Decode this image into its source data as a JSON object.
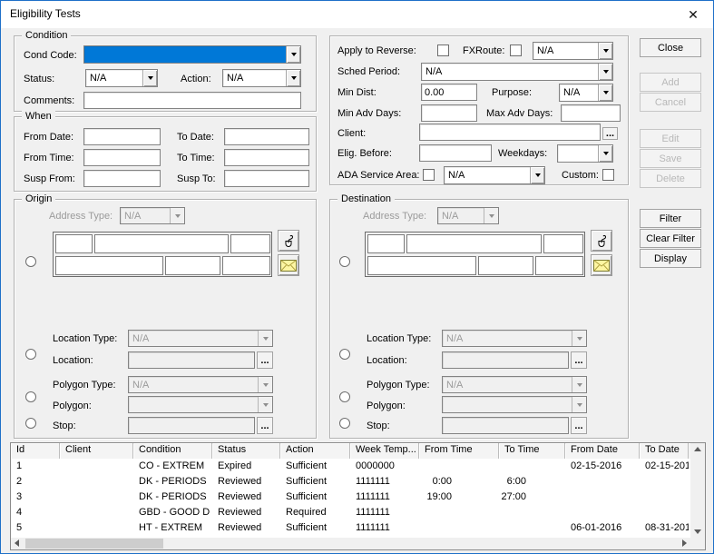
{
  "window": {
    "title": "Eligibility Tests",
    "close_glyph": "✕"
  },
  "colors": {
    "accent": "#0078d7",
    "cond_code_selection": "#0078d7",
    "envelope_yellow": "#fdf6a3"
  },
  "icons": {
    "close": "close-icon",
    "dropdown": "chevron-down-icon",
    "address_pick": "mouse-icon",
    "address_mail": "envelope-icon",
    "browse": "ellipsis-icon",
    "scroll_arrows": [
      "arrow-up-icon",
      "arrow-down-icon",
      "arrow-left-icon",
      "arrow-right-icon"
    ]
  },
  "condition": {
    "legend": "Condition",
    "cond_code_label": "Cond Code:",
    "cond_code_value": "",
    "status_label": "Status:",
    "status_value": "N/A",
    "action_label": "Action:",
    "action_value": "N/A",
    "comments_label": "Comments:",
    "comments_value": ""
  },
  "options": {
    "apply_to_reverse_label": "Apply to Reverse:",
    "fxroute_label": "FXRoute:",
    "fxroute_value": "N/A",
    "sched_period_label": "Sched Period:",
    "sched_period_value": "N/A",
    "min_dist_label": "Min Dist:",
    "min_dist_value": "0.00",
    "purpose_label": "Purpose:",
    "purpose_value": "N/A",
    "min_adv_days_label": "Min Adv Days:",
    "min_adv_days_value": "",
    "max_adv_days_label": "Max Adv Days:",
    "max_adv_days_value": "",
    "client_label": "Client:",
    "client_value": "",
    "browse_label": "...",
    "elig_before_label": "Elig. Before:",
    "elig_before_value": "",
    "weekdays_label": "Weekdays:",
    "weekdays_value": "",
    "ada_service_area_label": "ADA Service Area:",
    "ada_service_area_value": "N/A",
    "custom_label": "Custom:"
  },
  "buttons": {
    "close": "Close",
    "add": "Add",
    "cancel": "Cancel",
    "edit": "Edit",
    "save": "Save",
    "delete": "Delete",
    "filter": "Filter",
    "clear_filter": "Clear Filter",
    "display": "Display"
  },
  "when": {
    "legend": "When",
    "from_date_label": "From Date:",
    "from_date_value": "",
    "to_date_label": "To Date:",
    "to_date_value": "",
    "from_time_label": "From Time:",
    "from_time_value": "",
    "to_time_label": "To Time:",
    "to_time_value": "",
    "susp_from_label": "Susp From:",
    "susp_from_value": "",
    "susp_to_label": "Susp To:",
    "susp_to_value": ""
  },
  "origin": {
    "legend": "Origin",
    "address_type_label": "Address Type:",
    "address_type_value": "N/A",
    "location_type_label": "Location Type:",
    "location_type_value": "N/A",
    "location_label": "Location:",
    "location_value": "",
    "polygon_type_label": "Polygon Type:",
    "polygon_type_value": "N/A",
    "polygon_label": "Polygon:",
    "polygon_value": "",
    "stop_label": "Stop:",
    "stop_value": "",
    "browse_label": "..."
  },
  "destination": {
    "legend": "Destination",
    "address_type_label": "Address Type:",
    "address_type_value": "N/A",
    "location_type_label": "Location Type:",
    "location_type_value": "N/A",
    "location_label": "Location:",
    "location_value": "",
    "polygon_type_label": "Polygon Type:",
    "polygon_type_value": "N/A",
    "polygon_label": "Polygon:",
    "polygon_value": "",
    "stop_label": "Stop:",
    "stop_value": "",
    "browse_label": "..."
  },
  "table": {
    "columns": [
      "Id",
      "Client",
      "Condition",
      "Status",
      "Action",
      "Week Temp...",
      "From Time",
      "To Time",
      "From Date",
      "To Date"
    ],
    "rows": [
      [
        "1",
        "",
        "CO - EXTREM",
        "Expired",
        "Sufficient",
        "0000000",
        "",
        "",
        "02-15-2016",
        "02-15-201"
      ],
      [
        "2",
        "",
        "DK - PERIODS",
        "Reviewed",
        "Sufficient",
        "1111111",
        "0:00",
        "6:00",
        "",
        ""
      ],
      [
        "3",
        "",
        "DK - PERIODS",
        "Reviewed",
        "Sufficient",
        "1111111",
        "19:00",
        "27:00",
        "",
        ""
      ],
      [
        "4",
        "",
        "GBD - GOOD D",
        "Reviewed",
        "Required",
        "1111111",
        "",
        "",
        "",
        ""
      ],
      [
        "5",
        "",
        "HT - EXTREM",
        "Reviewed",
        "Sufficient",
        "1111111",
        "",
        "",
        "06-01-2016",
        "08-31-201"
      ]
    ]
  }
}
